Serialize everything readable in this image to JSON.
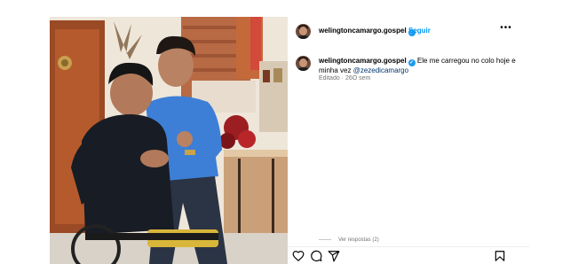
{
  "post": {
    "username": "welingtoncamargo.gospel",
    "verified_mark": "✓",
    "separator": "•",
    "follow_label": "Seguir",
    "more_label": "•••"
  },
  "caption": {
    "username": "welingtoncamargo.gospel",
    "text": "Ele me carregou no colo hoje e minha vez",
    "mention": "@zezedicamargo",
    "meta": "Editado · 26O sem"
  },
  "replies": {
    "label": "Ver respostas (2)"
  },
  "actions": {
    "like_icon": "heart-icon",
    "comment_icon": "comment-icon",
    "share_icon": "paper-plane-icon",
    "save_icon": "bookmark-icon"
  },
  "colors": {
    "accent": "#0095f6",
    "verified": "#1d9bf0",
    "mention": "#00376b",
    "muted": "#737373"
  }
}
